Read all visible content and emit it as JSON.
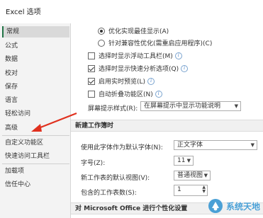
{
  "window": {
    "title": "Excel 选项"
  },
  "sidebar": {
    "items": [
      {
        "label": "常规",
        "active": true
      },
      {
        "label": "公式"
      },
      {
        "label": "数据"
      },
      {
        "label": "校对"
      },
      {
        "label": "保存"
      },
      {
        "label": "语言"
      },
      {
        "label": "轻松访问"
      },
      {
        "label": "高级"
      },
      {
        "label": "自定义功能区"
      },
      {
        "label": "快速访问工具栏"
      },
      {
        "label": "加载项"
      },
      {
        "label": "信任中心"
      }
    ]
  },
  "general": {
    "radio_optimize_display": "优化实现最佳显示(A)",
    "radio_optimize_compat": "针对兼容性优化(需重启应用程序)(C)",
    "cb_mini_toolbar": "选择时显示浮动工具栏(M)",
    "cb_quick_analysis": "选择时显示快速分析选项(Q)",
    "cb_live_preview": "启用实时预览(L)",
    "cb_collapse_ribbon": "自动折叠功能区(N)",
    "tooltip_label": "屏幕提示样式(R):",
    "tooltip_value": "在屏幕提示中显示功能说明"
  },
  "new_workbook": {
    "section_title": "新建工作簿时",
    "font_label": "使用此字体作为默认字体(N):",
    "font_value": "正文字体",
    "size_label": "字号(Z):",
    "size_value": "11",
    "view_label": "新工作表的默认视图(V):",
    "view_value": "普通视图",
    "sheets_label": "包含的工作表数(S):",
    "sheets_value": "1"
  },
  "personalize": {
    "section_title": "对 Microsoft Office 进行个性化设置"
  },
  "watermark": {
    "text": "系统天地"
  },
  "colors": {
    "accent": "#217346",
    "arrow": "#e0301e"
  }
}
